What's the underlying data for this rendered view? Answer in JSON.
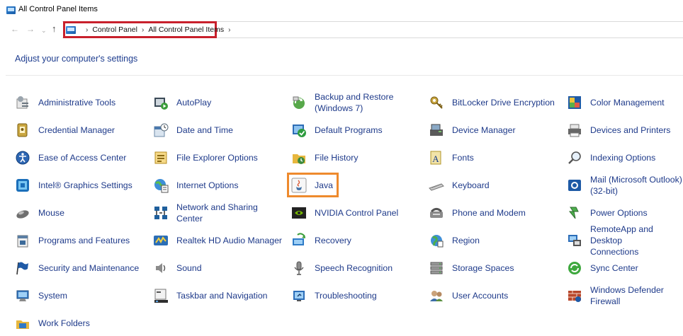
{
  "window": {
    "title": "All Control Panel Items"
  },
  "nav": {
    "back_icon": "back-arrow-icon",
    "forward_icon": "forward-arrow-icon",
    "recent_icon": "recent-locations-icon",
    "up_icon": "up-arrow-icon"
  },
  "breadcrumb": {
    "items": [
      "Control Panel",
      "All Control Panel Items"
    ],
    "separator": "›",
    "highlight_color": "#c8202c"
  },
  "main": {
    "heading": "Adjust your computer's settings",
    "highlight_color": "#ee8a2d",
    "columns": [
      [
        {
          "label": "Administrative Tools",
          "icon": "administrative-tools-icon"
        },
        {
          "label": "Credential Manager",
          "icon": "credential-manager-icon"
        },
        {
          "label": "Ease of Access Center",
          "icon": "ease-of-access-icon"
        },
        {
          "label": "Intel® Graphics Settings",
          "icon": "intel-graphics-icon"
        },
        {
          "label": "Mouse",
          "icon": "mouse-icon"
        },
        {
          "label": "Programs and Features",
          "icon": "programs-features-icon"
        },
        {
          "label": "Security and Maintenance",
          "icon": "security-flag-icon"
        },
        {
          "label": "System",
          "icon": "system-icon"
        },
        {
          "label": "Work Folders",
          "icon": "work-folders-icon"
        }
      ],
      [
        {
          "label": "AutoPlay",
          "icon": "autoplay-icon"
        },
        {
          "label": "Date and Time",
          "icon": "date-time-icon"
        },
        {
          "label": "File Explorer Options",
          "icon": "file-explorer-options-icon"
        },
        {
          "label": "Internet Options",
          "icon": "internet-options-icon"
        },
        {
          "label": "Network and Sharing\nCenter",
          "icon": "network-sharing-icon"
        },
        {
          "label": "Realtek HD Audio Manager",
          "icon": "realtek-audio-icon"
        },
        {
          "label": "Sound",
          "icon": "sound-icon"
        },
        {
          "label": "Taskbar and Navigation",
          "icon": "taskbar-icon"
        }
      ],
      [
        {
          "label": "Backup and Restore\n(Windows 7)",
          "icon": "backup-restore-icon"
        },
        {
          "label": "Default Programs",
          "icon": "default-programs-icon"
        },
        {
          "label": "File History",
          "icon": "file-history-icon"
        },
        {
          "label": "Java",
          "icon": "java-icon"
        },
        {
          "label": "NVIDIA Control Panel",
          "icon": "nvidia-icon"
        },
        {
          "label": "Recovery",
          "icon": "recovery-icon"
        },
        {
          "label": "Speech Recognition",
          "icon": "microphone-icon"
        },
        {
          "label": "Troubleshooting",
          "icon": "troubleshooting-icon"
        }
      ],
      [
        {
          "label": "BitLocker Drive Encryption",
          "icon": "bitlocker-key-icon"
        },
        {
          "label": "Device Manager",
          "icon": "device-manager-icon"
        },
        {
          "label": "Fonts",
          "icon": "fonts-icon"
        },
        {
          "label": "Keyboard",
          "icon": "keyboard-icon"
        },
        {
          "label": "Phone and Modem",
          "icon": "phone-modem-icon"
        },
        {
          "label": "Region",
          "icon": "region-globe-icon"
        },
        {
          "label": "Storage Spaces",
          "icon": "storage-spaces-icon"
        },
        {
          "label": "User Accounts",
          "icon": "user-accounts-icon"
        }
      ],
      [
        {
          "label": "Color Management",
          "icon": "color-management-icon"
        },
        {
          "label": "Devices and Printers",
          "icon": "printer-icon"
        },
        {
          "label": "Indexing Options",
          "icon": "indexing-options-icon"
        },
        {
          "label": "Mail (Microsoft Outlook)\n(32-bit)",
          "icon": "mail-icon"
        },
        {
          "label": "Power Options",
          "icon": "power-options-icon"
        },
        {
          "label": "RemoteApp and Desktop\nConnections",
          "icon": "remoteapp-icon"
        },
        {
          "label": "Sync Center",
          "icon": "sync-center-icon"
        },
        {
          "label": "Windows Defender\nFirewall",
          "icon": "firewall-icon"
        }
      ]
    ]
  }
}
